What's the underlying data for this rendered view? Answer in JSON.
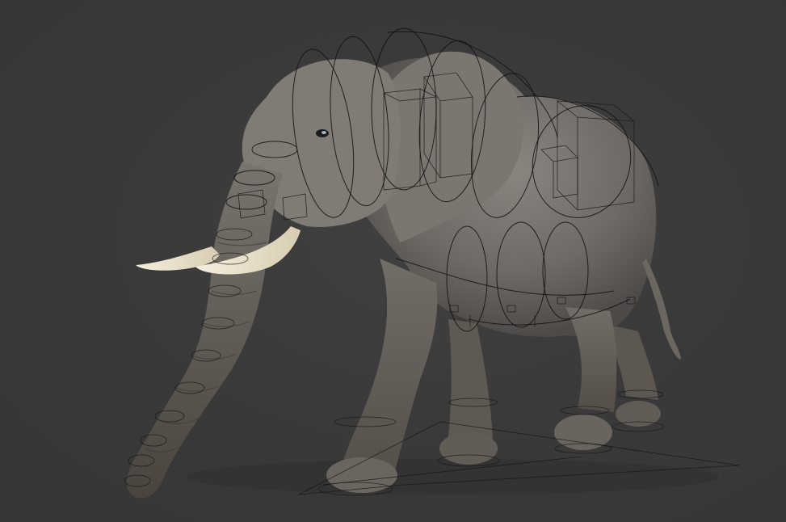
{
  "scene": {
    "subject": "elephant-3d-model",
    "background_color": "#393939",
    "skin_color": "#7d7772",
    "tusk_color": "#e9e1cc",
    "rig_line_color": "#111111"
  }
}
